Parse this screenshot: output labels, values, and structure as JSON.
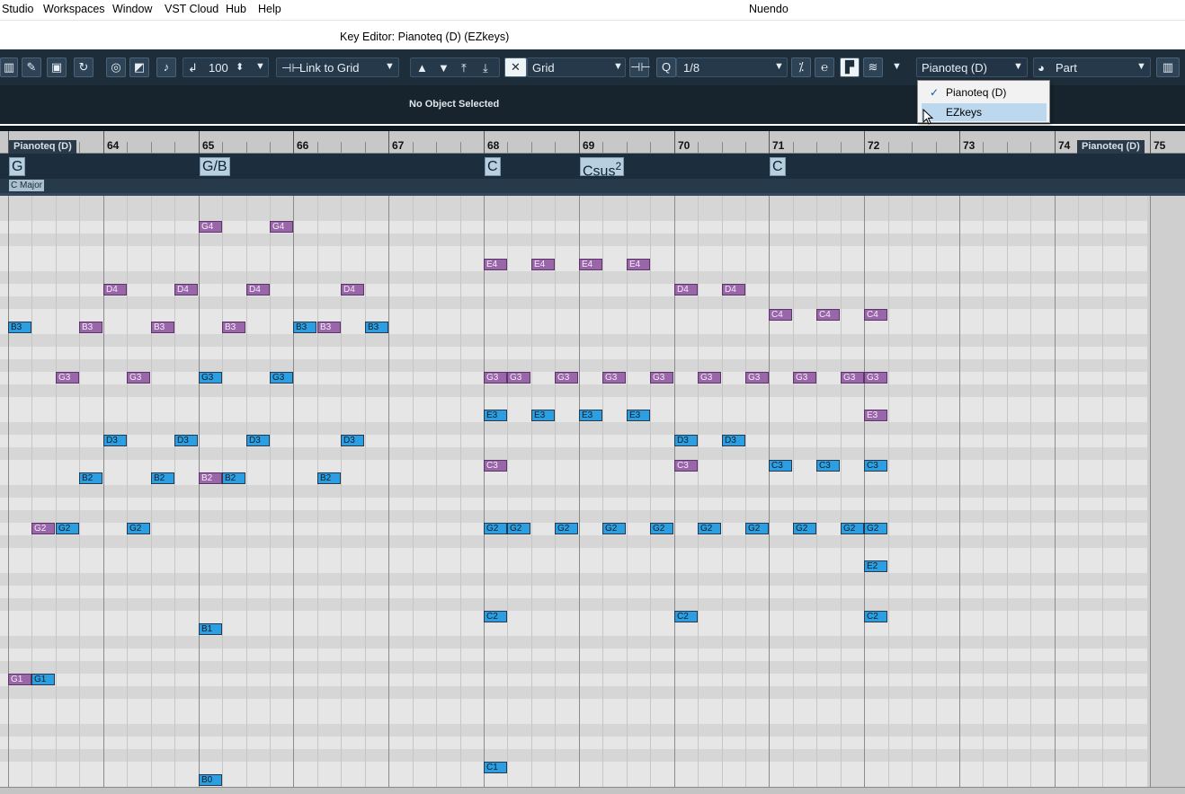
{
  "menubar": {
    "items": [
      "Studio",
      "Workspaces",
      "Window",
      "VST Cloud",
      "Hub",
      "Help"
    ],
    "app_title": "Nuendo"
  },
  "window": {
    "title": "Key Editor: Pianoteq  (D) (EZkeys)"
  },
  "toolbar": {
    "velocity": "100",
    "snap_mode": "Link to Grid",
    "grid_type": "Grid",
    "quantize": "1/8",
    "track_select": "Pianoteq  (D)",
    "part_select": "Part",
    "icons": [
      "left-edge-icon",
      "pencil-icon",
      "image-icon",
      "loop-icon",
      "draw-icon",
      "eraser-icon",
      "note-icon",
      "insert-velocity-icon",
      "up-arrow-icon",
      "down-arrow-icon",
      "step-up-icon",
      "step-down-icon",
      "snap-icon",
      "nudge-icon",
      "quantize-q-icon",
      "iterative-q-icon",
      "edit-in-place-icon",
      "editor-layout-icon",
      "lanes-icon",
      "part-icon",
      "keyboard-icon"
    ]
  },
  "info_line": {
    "status": "No Object Selected"
  },
  "ruler": {
    "bars": [
      "64",
      "65",
      "66",
      "67",
      "68",
      "69",
      "70",
      "71",
      "72",
      "73",
      "74",
      "75"
    ],
    "part_labels": [
      "Pianoteq  (D)",
      "Pianoteq  (D)"
    ]
  },
  "chord_track": {
    "chords": [
      {
        "name": "G",
        "sup": ""
      },
      {
        "name": "G/B",
        "sup": ""
      },
      {
        "name": "C",
        "sup": ""
      },
      {
        "name": "Csus",
        "sup": "2"
      },
      {
        "name": "C",
        "sup": ""
      }
    ],
    "scale": "C Major"
  },
  "notes": [
    {
      "label": "G4",
      "bar": 65.0,
      "row": 2,
      "color": "p"
    },
    {
      "label": "G4",
      "bar": 65.75,
      "row": 2,
      "color": "p"
    },
    {
      "label": "E4",
      "bar": 68.0,
      "row": 5,
      "color": "p"
    },
    {
      "label": "E4",
      "bar": 68.5,
      "row": 5,
      "color": "p"
    },
    {
      "label": "E4",
      "bar": 69.0,
      "row": 5,
      "color": "p"
    },
    {
      "label": "E4",
      "bar": 69.5,
      "row": 5,
      "color": "p"
    },
    {
      "label": "D4",
      "bar": 64.0,
      "row": 7,
      "color": "p"
    },
    {
      "label": "D4",
      "bar": 64.75,
      "row": 7,
      "color": "p"
    },
    {
      "label": "D4",
      "bar": 65.5,
      "row": 7,
      "color": "p"
    },
    {
      "label": "D4",
      "bar": 66.5,
      "row": 7,
      "color": "p"
    },
    {
      "label": "D4",
      "bar": 70.0,
      "row": 7,
      "color": "p"
    },
    {
      "label": "D4",
      "bar": 70.5,
      "row": 7,
      "color": "p"
    },
    {
      "label": "C4",
      "bar": 71.0,
      "row": 9,
      "color": "p"
    },
    {
      "label": "C4",
      "bar": 71.5,
      "row": 9,
      "color": "p"
    },
    {
      "label": "C4",
      "bar": 72.0,
      "row": 9,
      "color": "p"
    },
    {
      "label": "B3",
      "bar": 63.0,
      "row": 10,
      "color": "b"
    },
    {
      "label": "B3",
      "bar": 63.75,
      "row": 10,
      "color": "p"
    },
    {
      "label": "B3",
      "bar": 64.5,
      "row": 10,
      "color": "p"
    },
    {
      "label": "B3",
      "bar": 65.25,
      "row": 10,
      "color": "p"
    },
    {
      "label": "B3",
      "bar": 66.0,
      "row": 10,
      "color": "b"
    },
    {
      "label": "B3",
      "bar": 66.25,
      "row": 10,
      "color": "p"
    },
    {
      "label": "B3",
      "bar": 66.75,
      "row": 10,
      "color": "b"
    },
    {
      "label": "G3",
      "bar": 63.5,
      "row": 14,
      "color": "p"
    },
    {
      "label": "G3",
      "bar": 64.25,
      "row": 14,
      "color": "p"
    },
    {
      "label": "G3",
      "bar": 65.0,
      "row": 14,
      "color": "b"
    },
    {
      "label": "G3",
      "bar": 65.75,
      "row": 14,
      "color": "b"
    },
    {
      "label": "G3",
      "bar": 68.0,
      "row": 14,
      "color": "p"
    },
    {
      "label": "G3",
      "bar": 68.25,
      "row": 14,
      "color": "p"
    },
    {
      "label": "G3",
      "bar": 68.75,
      "row": 14,
      "color": "p"
    },
    {
      "label": "G3",
      "bar": 69.25,
      "row": 14,
      "color": "p"
    },
    {
      "label": "G3",
      "bar": 69.75,
      "row": 14,
      "color": "p"
    },
    {
      "label": "G3",
      "bar": 70.25,
      "row": 14,
      "color": "p"
    },
    {
      "label": "G3",
      "bar": 70.75,
      "row": 14,
      "color": "p"
    },
    {
      "label": "G3",
      "bar": 71.25,
      "row": 14,
      "color": "p"
    },
    {
      "label": "G3",
      "bar": 71.75,
      "row": 14,
      "color": "p"
    },
    {
      "label": "G3",
      "bar": 72.0,
      "row": 14,
      "color": "p"
    },
    {
      "label": "E3",
      "bar": 68.0,
      "row": 17,
      "color": "b"
    },
    {
      "label": "E3",
      "bar": 68.5,
      "row": 17,
      "color": "b"
    },
    {
      "label": "E3",
      "bar": 69.0,
      "row": 17,
      "color": "b"
    },
    {
      "label": "E3",
      "bar": 69.5,
      "row": 17,
      "color": "b"
    },
    {
      "label": "E3",
      "bar": 72.0,
      "row": 17,
      "color": "p"
    },
    {
      "label": "D3",
      "bar": 64.0,
      "row": 19,
      "color": "b"
    },
    {
      "label": "D3",
      "bar": 64.75,
      "row": 19,
      "color": "b"
    },
    {
      "label": "D3",
      "bar": 65.5,
      "row": 19,
      "color": "b"
    },
    {
      "label": "D3",
      "bar": 66.5,
      "row": 19,
      "color": "b"
    },
    {
      "label": "D3",
      "bar": 70.0,
      "row": 19,
      "color": "b"
    },
    {
      "label": "D3",
      "bar": 70.5,
      "row": 19,
      "color": "b"
    },
    {
      "label": "C3",
      "bar": 68.0,
      "row": 21,
      "color": "p"
    },
    {
      "label": "C3",
      "bar": 70.0,
      "row": 21,
      "color": "p"
    },
    {
      "label": "C3",
      "bar": 71.0,
      "row": 21,
      "color": "b"
    },
    {
      "label": "C3",
      "bar": 71.5,
      "row": 21,
      "color": "b"
    },
    {
      "label": "C3",
      "bar": 72.0,
      "row": 21,
      "color": "b"
    },
    {
      "label": "B2",
      "bar": 63.75,
      "row": 22,
      "color": "b"
    },
    {
      "label": "B2",
      "bar": 64.5,
      "row": 22,
      "color": "b"
    },
    {
      "label": "B2",
      "bar": 65.0,
      "row": 22,
      "color": "p"
    },
    {
      "label": "B2",
      "bar": 65.25,
      "row": 22,
      "color": "b"
    },
    {
      "label": "B2",
      "bar": 66.25,
      "row": 22,
      "color": "b"
    },
    {
      "label": "G2",
      "bar": 63.25,
      "row": 26,
      "color": "p"
    },
    {
      "label": "G2",
      "bar": 63.5,
      "row": 26,
      "color": "b"
    },
    {
      "label": "G2",
      "bar": 64.25,
      "row": 26,
      "color": "b"
    },
    {
      "label": "G2",
      "bar": 68.0,
      "row": 26,
      "color": "b"
    },
    {
      "label": "G2",
      "bar": 68.25,
      "row": 26,
      "color": "b"
    },
    {
      "label": "G2",
      "bar": 68.75,
      "row": 26,
      "color": "b"
    },
    {
      "label": "G2",
      "bar": 69.25,
      "row": 26,
      "color": "b"
    },
    {
      "label": "G2",
      "bar": 69.75,
      "row": 26,
      "color": "b"
    },
    {
      "label": "G2",
      "bar": 70.25,
      "row": 26,
      "color": "b"
    },
    {
      "label": "G2",
      "bar": 70.75,
      "row": 26,
      "color": "b"
    },
    {
      "label": "G2",
      "bar": 71.25,
      "row": 26,
      "color": "b"
    },
    {
      "label": "G2",
      "bar": 71.75,
      "row": 26,
      "color": "b"
    },
    {
      "label": "G2",
      "bar": 72.0,
      "row": 26,
      "color": "b"
    },
    {
      "label": "E2",
      "bar": 72.0,
      "row": 29,
      "color": "b"
    },
    {
      "label": "C2",
      "bar": 68.0,
      "row": 33,
      "color": "b"
    },
    {
      "label": "C2",
      "bar": 70.0,
      "row": 33,
      "color": "b"
    },
    {
      "label": "C2",
      "bar": 72.0,
      "row": 33,
      "color": "b"
    },
    {
      "label": "B1",
      "bar": 65.0,
      "row": 34,
      "color": "b"
    },
    {
      "label": "G1",
      "bar": 63.0,
      "row": 38,
      "color": "p"
    },
    {
      "label": "G1",
      "bar": 63.25,
      "row": 38,
      "color": "b"
    },
    {
      "label": "C1",
      "bar": 68.0,
      "row": 45,
      "color": "b"
    },
    {
      "label": "B0",
      "bar": 65.0,
      "row": 46,
      "color": "b"
    }
  ],
  "dropdown": {
    "items": [
      "Pianoteq  (D)",
      "EZkeys"
    ],
    "checked": "Pianoteq  (D)",
    "highlighted": "EZkeys"
  },
  "colors": {
    "toolbar_bg": "#1d2d3a",
    "note_blue": "#2b9fe2",
    "note_purple": "#9a66aa",
    "dropdown_highlight": "#bcd8ef"
  }
}
